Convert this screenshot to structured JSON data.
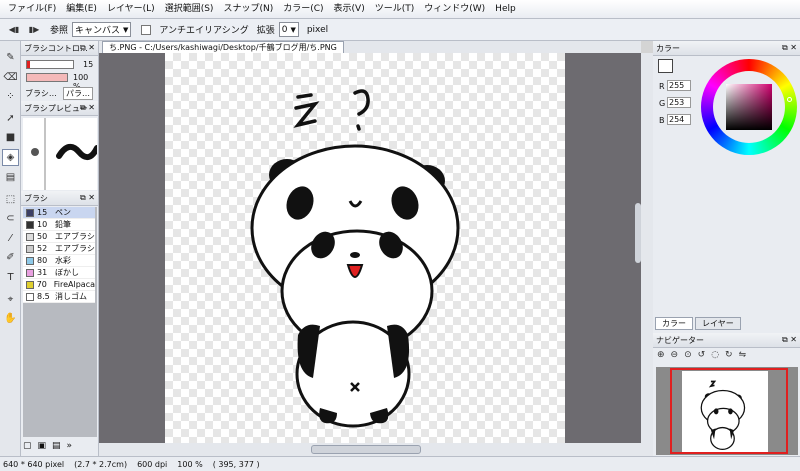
{
  "menu": [
    "ファイル(F)",
    "編集(E)",
    "レイヤー(L)",
    "選択範囲(S)",
    "スナップ(N)",
    "カラー(C)",
    "表示(V)",
    "ツール(T)",
    "ウィンドウ(W)",
    "Help"
  ],
  "toolbar": {
    "ref_label": "参照",
    "ref_value": "キャンバス",
    "antialias_label": "アンチエイリアシング",
    "expand_label": "拡張",
    "expand_value": "0",
    "unit": "pixel"
  },
  "brush_control": {
    "title": "ブラシコントロ…",
    "size": "15",
    "opacity": "100 %",
    "btn_brush": "ブラシ…",
    "btn_params": "パラ…"
  },
  "brush_preview": {
    "title": "ブラシプレビュー"
  },
  "brush_list": {
    "title": "ブラシ",
    "items": [
      {
        "size": "15",
        "name": "ペン",
        "color": "#3b3f66"
      },
      {
        "size": "10",
        "name": "鉛筆",
        "color": "#333333"
      },
      {
        "size": "50",
        "name": "エアブラシ",
        "color": "#dddddd"
      },
      {
        "size": "52",
        "name": "エアブラシ",
        "color": "#cccccc"
      },
      {
        "size": "80",
        "name": "水彩",
        "color": "#8ec9e8"
      },
      {
        "size": "31",
        "name": "ぼかし",
        "color": "#e8a0e0"
      },
      {
        "size": "70",
        "name": "FireAlpaca",
        "color": "#e0d030"
      },
      {
        "size": "8.5",
        "name": "消しゴム",
        "color": "#ffffff"
      }
    ]
  },
  "document_tab": "ち.PNG - C:/Users/kashiwagi/Desktop/千鶴ブログ用/ち.PNG",
  "color_panel": {
    "title": "カラー",
    "R": "255",
    "G": "253",
    "B": "254"
  },
  "panel_tabs": [
    "カラー",
    "レイヤー"
  ],
  "navigator": {
    "title": "ナビゲーター"
  },
  "status": {
    "dimensions": "640 * 640 pixel",
    "physical": "(2.7 * 2.7cm)",
    "dpi": "600 dpi",
    "zoom": "100 %",
    "cursor": "( 395, 377 )"
  },
  "colors": {
    "accent": "#e02020",
    "chrome": "#e9ecf1"
  }
}
